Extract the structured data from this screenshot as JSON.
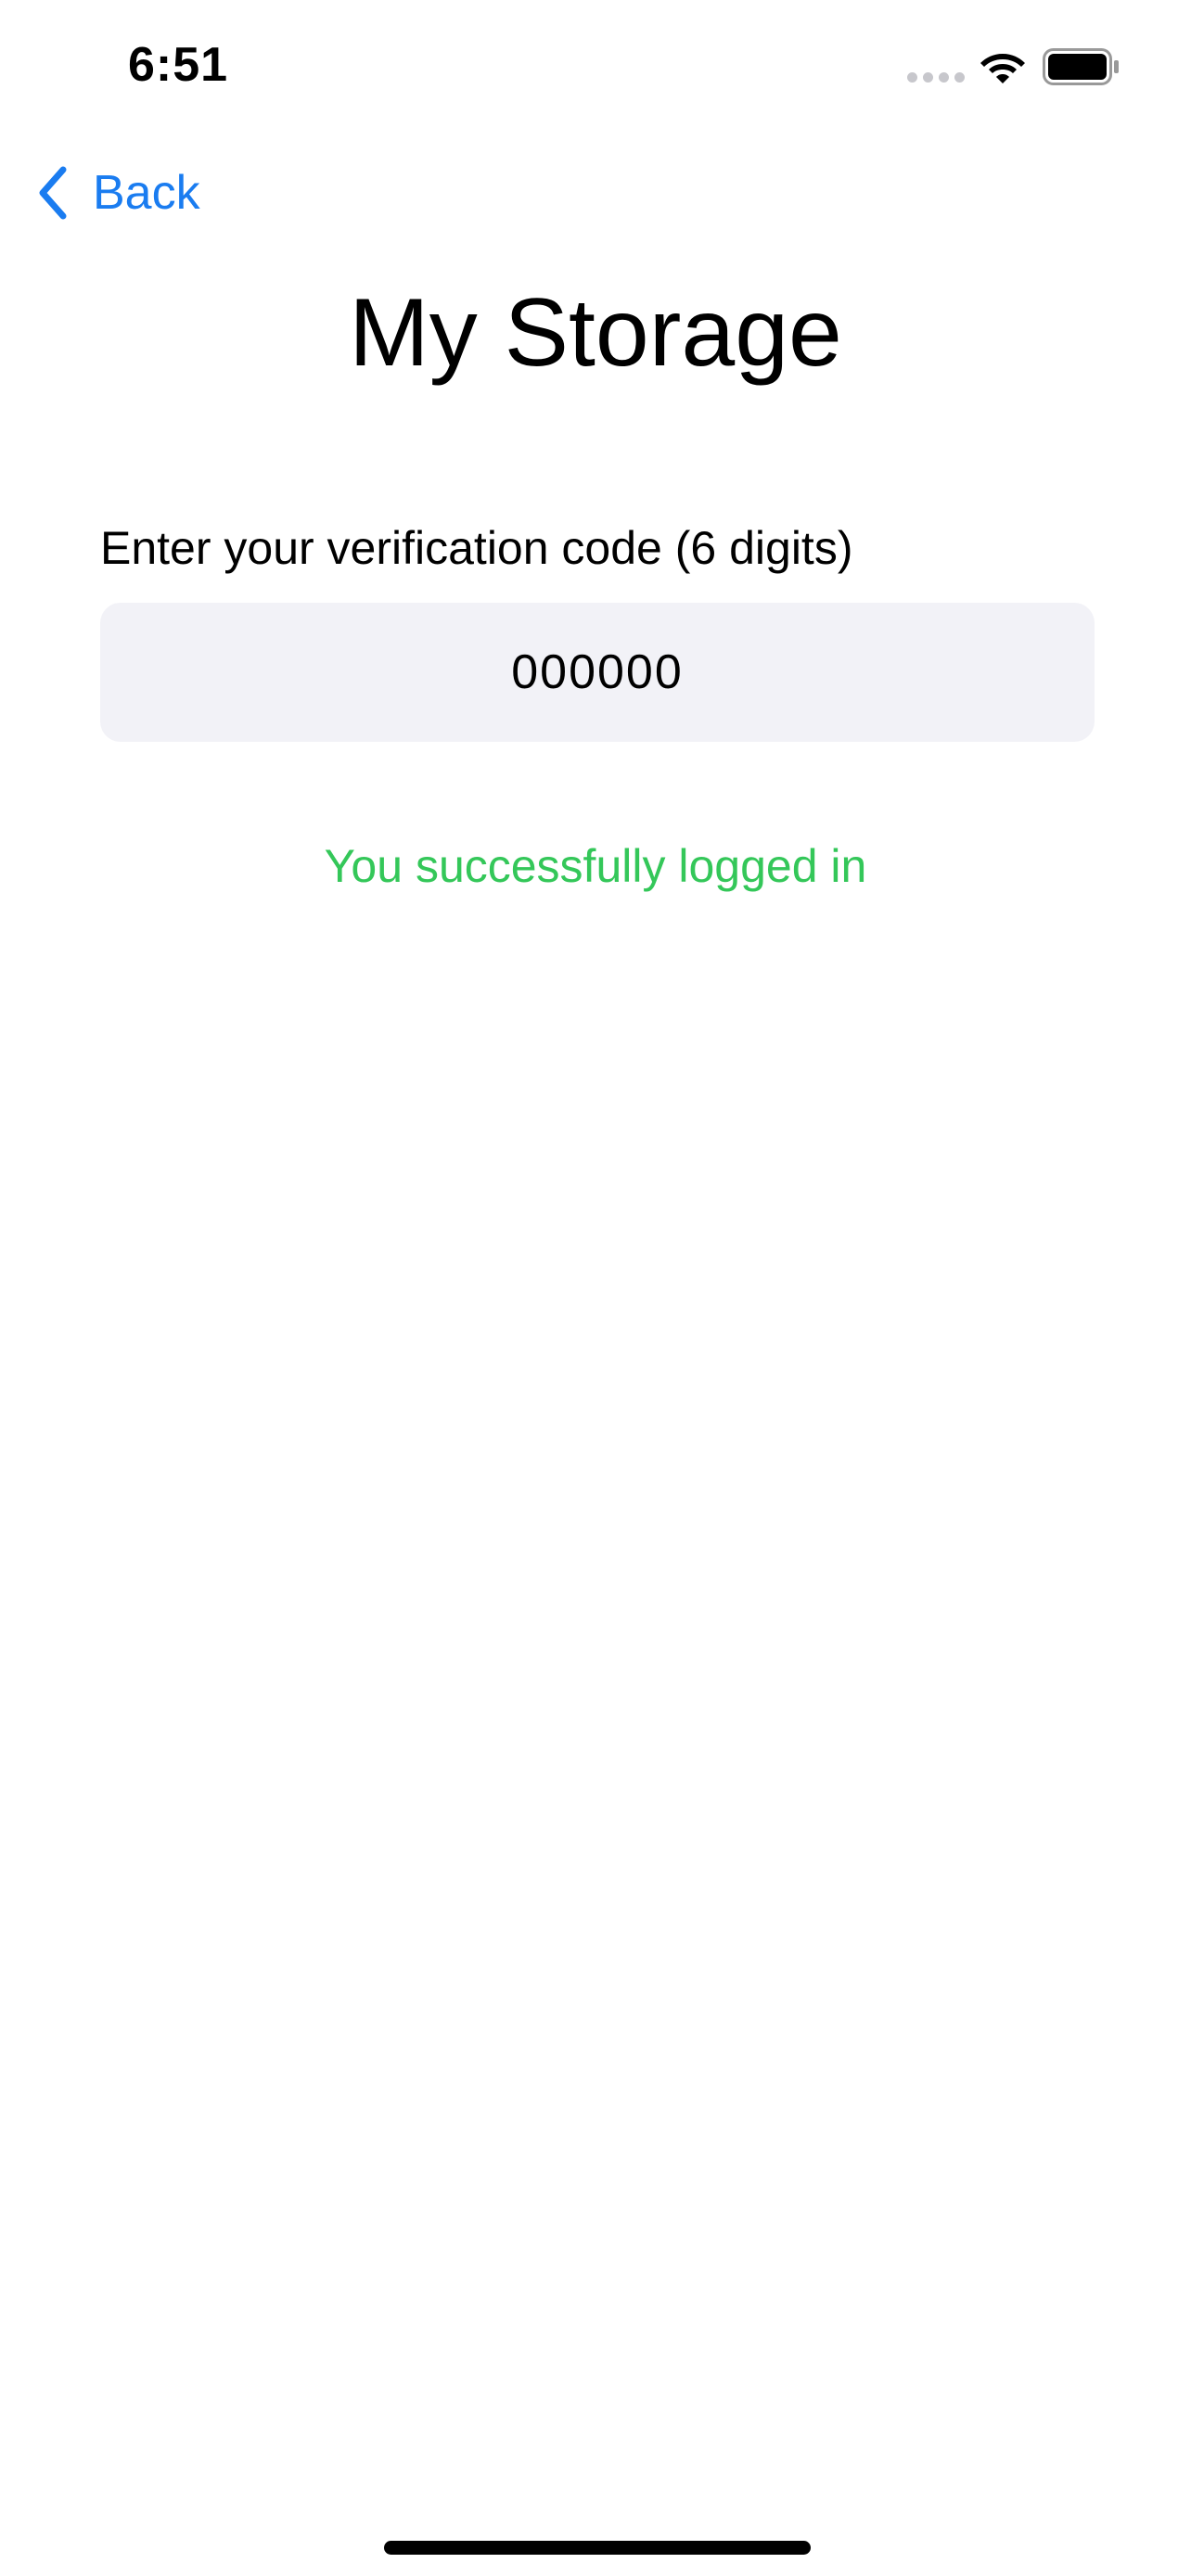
{
  "status_bar": {
    "time": "6:51",
    "signal_icon": "cellular-signal-dots-icon",
    "wifi_icon": "wifi-icon",
    "battery_icon": "battery-full-icon",
    "signal_color": "#c7c7cc",
    "icon_color": "#000000"
  },
  "nav": {
    "back_label": "Back",
    "back_icon": "chevron-left-icon",
    "accent_color": "#1a7cf0"
  },
  "page": {
    "title": "My Storage"
  },
  "verification": {
    "label": "Enter your verification code (6 digits)",
    "value": "000000",
    "field_bg": "#f2f2f7"
  },
  "result": {
    "message": "You successfully logged in",
    "color": "#34c759"
  },
  "home_indicator_color": "#000000"
}
